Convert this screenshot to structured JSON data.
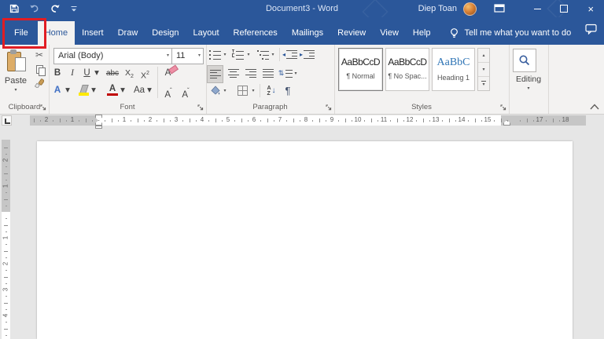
{
  "titlebar": {
    "title": "Document3 - Word",
    "user": "Diep Toan"
  },
  "tabs": [
    {
      "label": "File"
    },
    {
      "label": "Home"
    },
    {
      "label": "Insert"
    },
    {
      "label": "Draw"
    },
    {
      "label": "Design"
    },
    {
      "label": "Layout"
    },
    {
      "label": "References"
    },
    {
      "label": "Mailings"
    },
    {
      "label": "Review"
    },
    {
      "label": "View"
    },
    {
      "label": "Help"
    }
  ],
  "tell_me": "Tell me what you want to do",
  "ribbon": {
    "clipboard": {
      "label": "Clipboard",
      "paste": "Paste"
    },
    "font": {
      "label": "Font",
      "family": "Arial (Body)",
      "size": "11",
      "bold": "B",
      "italic": "I",
      "underline": "U",
      "strikethrough": "abc",
      "sub_base": "X",
      "sub_mark": "2",
      "sup_base": "X",
      "sup_mark": "2",
      "clear_format": "A",
      "text_effects": "A",
      "font_color": "A",
      "change_case": "Aa",
      "grow": "A",
      "grow_mark": "ˆ",
      "shrink": "A",
      "shrink_mark": "ˇ"
    },
    "paragraph": {
      "label": "Paragraph",
      "pilcrow": "¶",
      "sort_top": "A",
      "sort_bottom": "Z",
      "sort_arrow": "↓"
    },
    "styles": {
      "label": "Styles",
      "items": [
        {
          "preview": "AaBbCcD",
          "name": "¶ Normal",
          "selected": true
        },
        {
          "preview": "AaBbCcD",
          "name": "¶ No Spac..."
        },
        {
          "preview": "AaBbC",
          "name": "Heading 1"
        }
      ]
    },
    "editing": {
      "label": "Editing"
    }
  },
  "ruler": {
    "h_marks": [
      {
        "label": "2",
        "unit": -2
      },
      {
        "label": "1",
        "unit": -1
      },
      {
        "label": "1",
        "unit": 1
      },
      {
        "label": "2",
        "unit": 2
      },
      {
        "label": "3",
        "unit": 3
      },
      {
        "label": "4",
        "unit": 4
      },
      {
        "label": "5",
        "unit": 5
      },
      {
        "label": "6",
        "unit": 6
      },
      {
        "label": "7",
        "unit": 7
      },
      {
        "label": "8",
        "unit": 8
      },
      {
        "label": "9",
        "unit": 9
      },
      {
        "label": "10",
        "unit": 10
      },
      {
        "label": "11",
        "unit": 11
      },
      {
        "label": "12",
        "unit": 12
      },
      {
        "label": "13",
        "unit": 13
      },
      {
        "label": "14",
        "unit": 14
      },
      {
        "label": "15",
        "unit": 15
      },
      {
        "label": "17",
        "unit": 17
      },
      {
        "label": "18",
        "unit": 18
      }
    ],
    "v_marks": [
      {
        "label": "2",
        "unit": -2
      },
      {
        "label": "1",
        "unit": -1
      },
      {
        "label": "1",
        "unit": 1
      },
      {
        "label": "2",
        "unit": 2
      },
      {
        "label": "3",
        "unit": 3
      },
      {
        "label": "4",
        "unit": 4
      }
    ]
  },
  "colors": {
    "titlebar_blue": "#2b579a",
    "ribbon_bg": "#f3f2f1",
    "highlight_box_red": "#e11d23",
    "heading_style_blue": "#2e74b5",
    "font_color_red": "#c00000",
    "highlight_yellow": "#ffe900",
    "doc_area_gray": "#e6e6e6"
  },
  "icons": {
    "quick_access": [
      "save-icon",
      "undo-icon",
      "redo-icon",
      "customize-quick-access-icon"
    ],
    "titlebar_right": [
      "avatar",
      "ribbon-display-options-icon",
      "minimize-icon",
      "restore-icon",
      "close-icon"
    ],
    "tab_row": [
      "lightbulb-icon",
      "comment-icon"
    ],
    "clipboard": [
      "paste-icon",
      "cut-icon",
      "copy-icon",
      "format-painter-icon"
    ],
    "paragraph": [
      "bullets-icon",
      "numbering-icon",
      "multilevel-list-icon",
      "decrease-indent-icon",
      "increase-indent-icon",
      "align-left-icon",
      "align-center-icon",
      "align-right-icon",
      "justify-icon",
      "line-spacing-icon",
      "shading-icon",
      "borders-icon",
      "sort-icon",
      "show-hide-icon"
    ],
    "editing": [
      "search-icon"
    ],
    "ruler": [
      "tab-selector",
      "first-line-indent-marker",
      "hanging-indent-marker",
      "left-indent-marker",
      "right-indent-marker"
    ]
  }
}
